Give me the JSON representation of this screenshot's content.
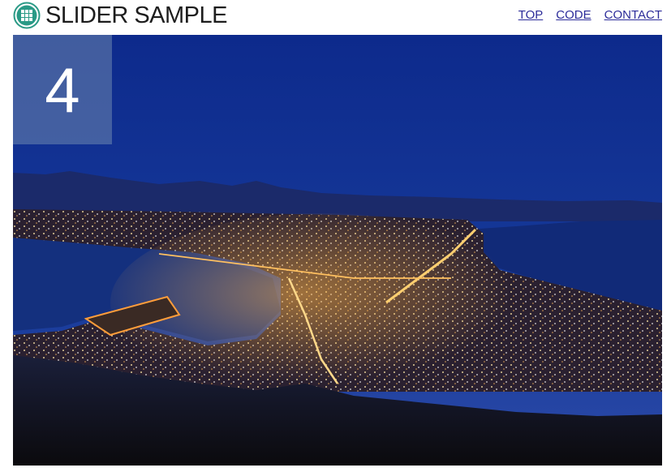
{
  "header": {
    "title": "SLIDER SAMPLE",
    "logo_icon": "grid-circle-icon",
    "accent_color": "#2a9a86"
  },
  "nav": {
    "items": [
      {
        "label": "TOP"
      },
      {
        "label": "CODE"
      },
      {
        "label": "CONTACT"
      }
    ],
    "link_color": "#2d2d9a"
  },
  "slider": {
    "current_slide": "4",
    "image_subject": "night-city-view-photo"
  }
}
